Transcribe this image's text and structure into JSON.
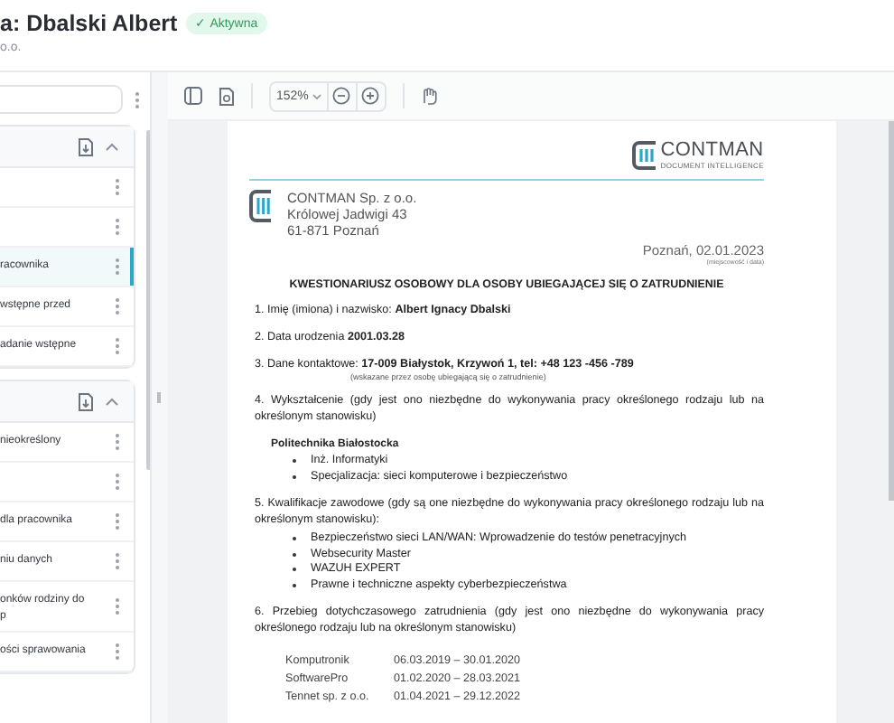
{
  "header": {
    "title": "a: Dbalski Albert",
    "status": {
      "label": "Aktywna",
      "icon": "✓",
      "active": true
    },
    "subtitle": "o.o."
  },
  "sidebar": {
    "groups": [
      {
        "expanded": true,
        "items": [
          {
            "selected": false
          },
          {
            "selected": false
          },
          {
            "lines": [
              "racownika"
            ],
            "selected": true
          },
          {
            "lines": [
              "wstępne przed"
            ],
            "selected": false
          },
          {
            "lines": [
              "adanie wstępne"
            ],
            "selected": false
          }
        ]
      },
      {
        "expanded": true,
        "items": [
          {
            "lines": [
              "nieokreślony"
            ],
            "selected": false
          },
          {
            "selected": false
          },
          {
            "lines": [
              "dla pracownika"
            ],
            "selected": false
          },
          {
            "lines": [
              "niu danych"
            ],
            "selected": false
          },
          {
            "lines": [
              "onków rodziny do",
              "p"
            ],
            "selected": false
          },
          {
            "lines": [
              "ości sprawowania"
            ],
            "selected": false
          }
        ]
      }
    ]
  },
  "toolbar": {
    "zoom": "152%"
  },
  "document": {
    "logo": {
      "name": "CONTMAN",
      "tagline": "DOCUMENT INTELLIGENCE"
    },
    "address": [
      "CONTMAN Sp. z o.o.",
      "Królowej Jadwigi 43",
      "61-871 Poznań"
    ],
    "place_date": "Poznań, 02.01.2023",
    "place_date_caption": "(miejscowość i data)",
    "title": "KWESTIONARIUSZ OSOBOWY DLA OSOBY UBIEGAJĄCEJ SIĘ O ZATRUDNIENIE",
    "blocks": [
      {
        "kind": "para",
        "text": "1. Imię (imiona) i nazwisko: **Albert Ignacy Dbalski**"
      },
      {
        "kind": "para",
        "text": "2. Data urodzenia **2001.03.28**"
      },
      {
        "kind": "para",
        "text": "3. Dane kontaktowe: **17-009 Białystok, Krzywoń 1, tel: +48 123 -456 -789**"
      },
      {
        "kind": "note",
        "text": "(wskazane przez osobę ubiegającą się o zatrudnienie)"
      },
      {
        "kind": "para",
        "text": "4. Wykształcenie (gdy jest ono niezbędne do wykonywania pracy określonego rodzaju lub na określonym stanowisku)"
      },
      {
        "kind": "subhead",
        "text": "Politechnika Białostocka"
      },
      {
        "kind": "bullets",
        "items": [
          "Inż. Informatyki",
          "Specjalizacja: sieci komputerowe i bezpieczeństwo"
        ]
      },
      {
        "kind": "para",
        "text": "5. Kwalifikacje zawodowe (gdy są one niezbędne do wykonywania pracy określonego rodzaju lub na określonym stanowisku):"
      },
      {
        "kind": "bullets",
        "items": [
          "Bezpieczeństwo sieci LAN/WAN: Wprowadzenie do testów penetracyjnych",
          "Websecurity Master",
          "WAZUH EXPERT",
          "Prawne i techniczne aspekty cyberbezpieczeństwa"
        ]
      },
      {
        "kind": "para",
        "text": "6. Przebieg dotychczasowego zatrudnienia (gdy jest ono niezbędne do wykonywania pracy określonego rodzaju lub na określonym stanowisku)"
      },
      {
        "kind": "table",
        "rows": [
          [
            "Komputronik",
            "06.03.2019 – 30.01.2020"
          ],
          [
            "SoftwarePro",
            "01.02.2020 – 28.03.2021"
          ],
          [
            "Tennet sp. z o.o.",
            "01.04.2021 – 29.12.2022"
          ]
        ]
      }
    ]
  }
}
